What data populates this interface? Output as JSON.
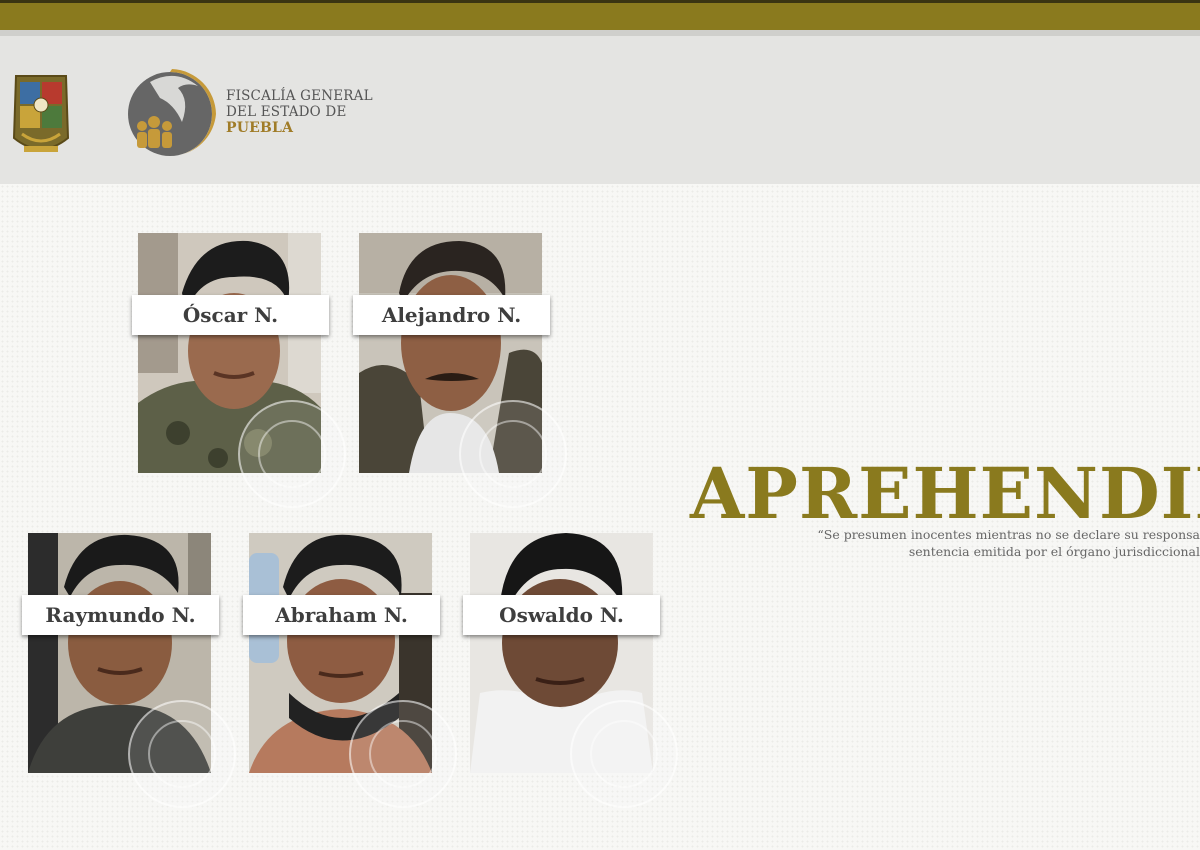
{
  "header": {
    "logo_line1": "FISCALÍA GENERAL",
    "logo_line2": "DEL ESTADO DE",
    "logo_line3": "PUEBLA"
  },
  "detainees": [
    {
      "name": "Óscar N."
    },
    {
      "name": "Alejandro N."
    },
    {
      "name": "Raymundo N."
    },
    {
      "name": "Abraham N."
    },
    {
      "name": "Oswaldo N."
    }
  ],
  "headline": "APREHENDID",
  "disclaimer_line1": "“Se presumen inocentes mientras no se declare su responsa",
  "disclaimer_line2": "sentencia emitida por el órgano jurisdiccional",
  "colors": {
    "gold": "#8a7a1e",
    "header_bg": "#e4e4e2",
    "name_text": "#3e3e3e"
  }
}
